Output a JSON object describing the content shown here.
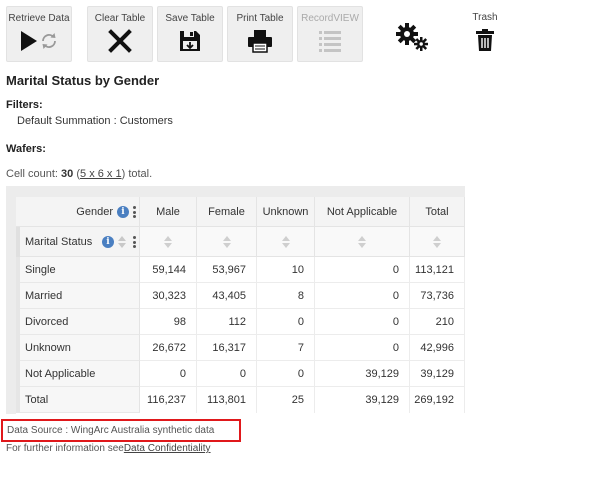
{
  "toolbar": {
    "retrieve_label": "Retrieve Data",
    "clear_label": "Clear Table",
    "save_label": "Save Table",
    "print_label": "Print Table",
    "recordview_label": "RecordVIEW",
    "trash_label": "Trash"
  },
  "page": {
    "title": "Marital Status by Gender",
    "filters_label": "Filters:",
    "filter_value": "Default Summation : Customers",
    "wafers_label": "Wafers:",
    "cellcount_prefix": "Cell count: ",
    "cellcount_value": "30",
    "cellcount_open": " (",
    "cellcount_dims": "5 x 6 x 1",
    "cellcount_suffix": ") total."
  },
  "table": {
    "col_group_label": "Gender",
    "row_group_label": "Marital Status",
    "columns": [
      "Male",
      "Female",
      "Unknown",
      "Not Applicable",
      "Total"
    ],
    "rows": [
      {
        "label": "Single",
        "values": [
          "59,144",
          "53,967",
          "10",
          "0",
          "113,121"
        ]
      },
      {
        "label": "Married",
        "values": [
          "30,323",
          "43,405",
          "8",
          "0",
          "73,736"
        ]
      },
      {
        "label": "Divorced",
        "values": [
          "98",
          "112",
          "0",
          "0",
          "210"
        ]
      },
      {
        "label": "Unknown",
        "values": [
          "26,672",
          "16,317",
          "7",
          "0",
          "42,996"
        ]
      },
      {
        "label": "Not Applicable",
        "values": [
          "0",
          "0",
          "0",
          "39,129",
          "39,129"
        ]
      },
      {
        "label": "Total",
        "values": [
          "116,237",
          "113,801",
          "25",
          "39,129",
          "269,192"
        ]
      }
    ]
  },
  "footer": {
    "datasource": "Data Source : WingArc Australia synthetic data",
    "further_prefix": "For further information see",
    "further_link": "Data Confidentiality"
  },
  "colors": {
    "highlight_border": "#e0181b",
    "info_icon": "#4a7fc1"
  }
}
